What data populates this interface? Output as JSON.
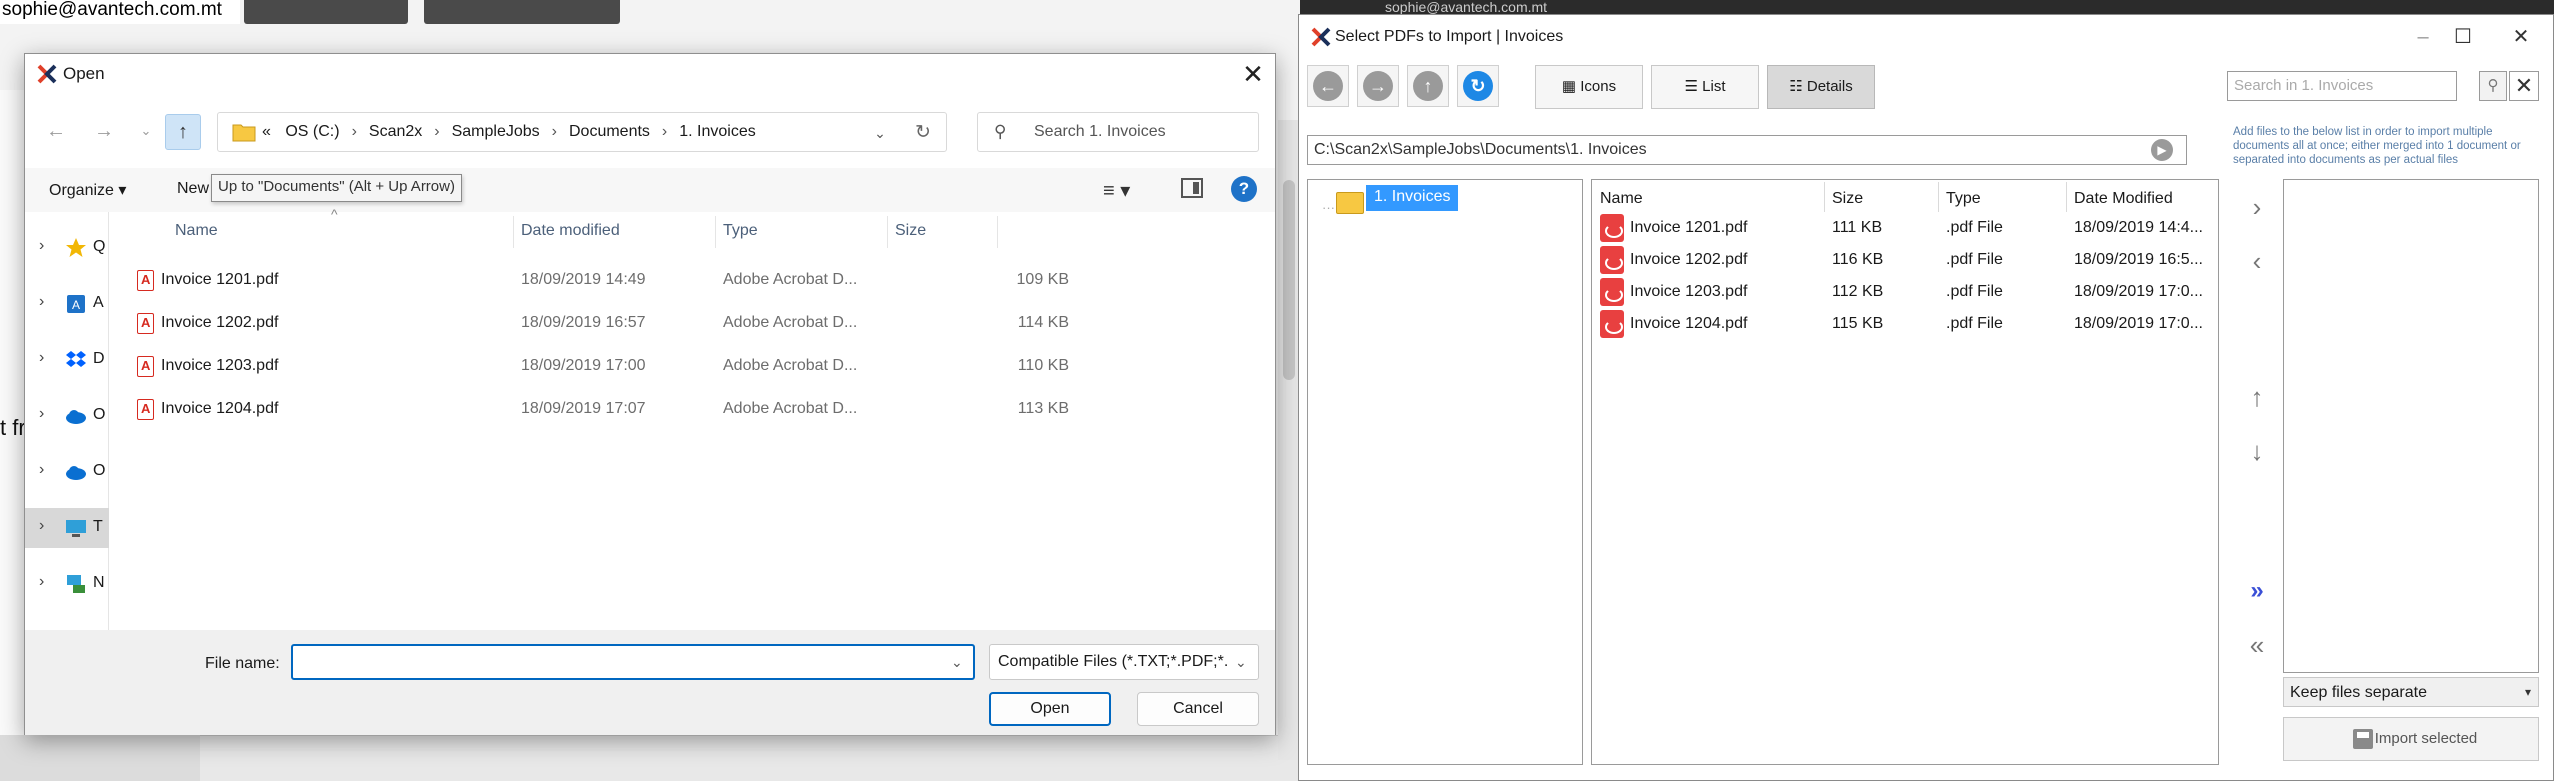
{
  "background": {
    "email": "sophie@avantech.com.mt",
    "side_text": "t fr",
    "right_email": "sophie@avantech.com.mt"
  },
  "open_dialog": {
    "title": "Open",
    "breadcrumb": {
      "overflow": "«",
      "parts": [
        "OS (C:)",
        "Scan2x",
        "SampleJobs",
        "Documents",
        "1. Invoices"
      ]
    },
    "search_placeholder": "Search 1. Invoices",
    "toolbar": {
      "organize": "Organize ▾",
      "new_folder": "New",
      "tooltip": "Up to \"Documents\" (Alt + Up Arrow)"
    },
    "nav_items": [
      {
        "label": "Q",
        "icon": "star-icon"
      },
      {
        "label": "A",
        "icon": "app-icon"
      },
      {
        "label": "D",
        "icon": "dropbox-icon"
      },
      {
        "label": "O",
        "icon": "onedrive-icon"
      },
      {
        "label": "O",
        "icon": "onedrive-icon"
      },
      {
        "label": "T",
        "icon": "this-pc-icon"
      },
      {
        "label": "N",
        "icon": "network-icon"
      }
    ],
    "columns": [
      "Name",
      "Date modified",
      "Type",
      "Size"
    ],
    "files": [
      {
        "name": "Invoice 1201.pdf",
        "date": "18/09/2019 14:49",
        "type": "Adobe Acrobat D...",
        "size": "109 KB"
      },
      {
        "name": "Invoice 1202.pdf",
        "date": "18/09/2019 16:57",
        "type": "Adobe Acrobat D...",
        "size": "114 KB"
      },
      {
        "name": "Invoice 1203.pdf",
        "date": "18/09/2019 17:00",
        "type": "Adobe Acrobat D...",
        "size": "110 KB"
      },
      {
        "name": "Invoice 1204.pdf",
        "date": "18/09/2019 17:07",
        "type": "Adobe Acrobat D...",
        "size": "113 KB"
      }
    ],
    "file_name_label": "File name:",
    "file_name_value": "",
    "file_type": "Compatible Files (*.TXT;*.PDF;*.",
    "open_label": "Open",
    "cancel_label": "Cancel"
  },
  "select_dialog": {
    "title": "Select PDFs to Import  |  Invoices",
    "view_buttons": [
      "Icons",
      "List",
      "Details"
    ],
    "search_placeholder": "Search in 1. Invoices",
    "path": "C:\\Scan2x\\SampleJobs\\Documents\\1. Invoices",
    "hint": "Add files to the below list in order to import multiple documents all at once; either merged into 1 document or separated into documents as per actual files",
    "tree_item": "1. Invoices",
    "columns": [
      "Name",
      "Size",
      "Type",
      "Date Modified"
    ],
    "files": [
      {
        "name": "Invoice 1201.pdf",
        "size": "111 KB",
        "type": ".pdf File",
        "date": "18/09/2019 14:4..."
      },
      {
        "name": "Invoice 1202.pdf",
        "size": "116 KB",
        "type": ".pdf File",
        "date": "18/09/2019 16:5..."
      },
      {
        "name": "Invoice 1203.pdf",
        "size": "112 KB",
        "type": ".pdf File",
        "date": "18/09/2019 17:0..."
      },
      {
        "name": "Invoice 1204.pdf",
        "size": "115 KB",
        "type": ".pdf File",
        "date": "18/09/2019 17:0..."
      }
    ],
    "keep_option": "Keep files separate",
    "import_label": "Import selected"
  }
}
